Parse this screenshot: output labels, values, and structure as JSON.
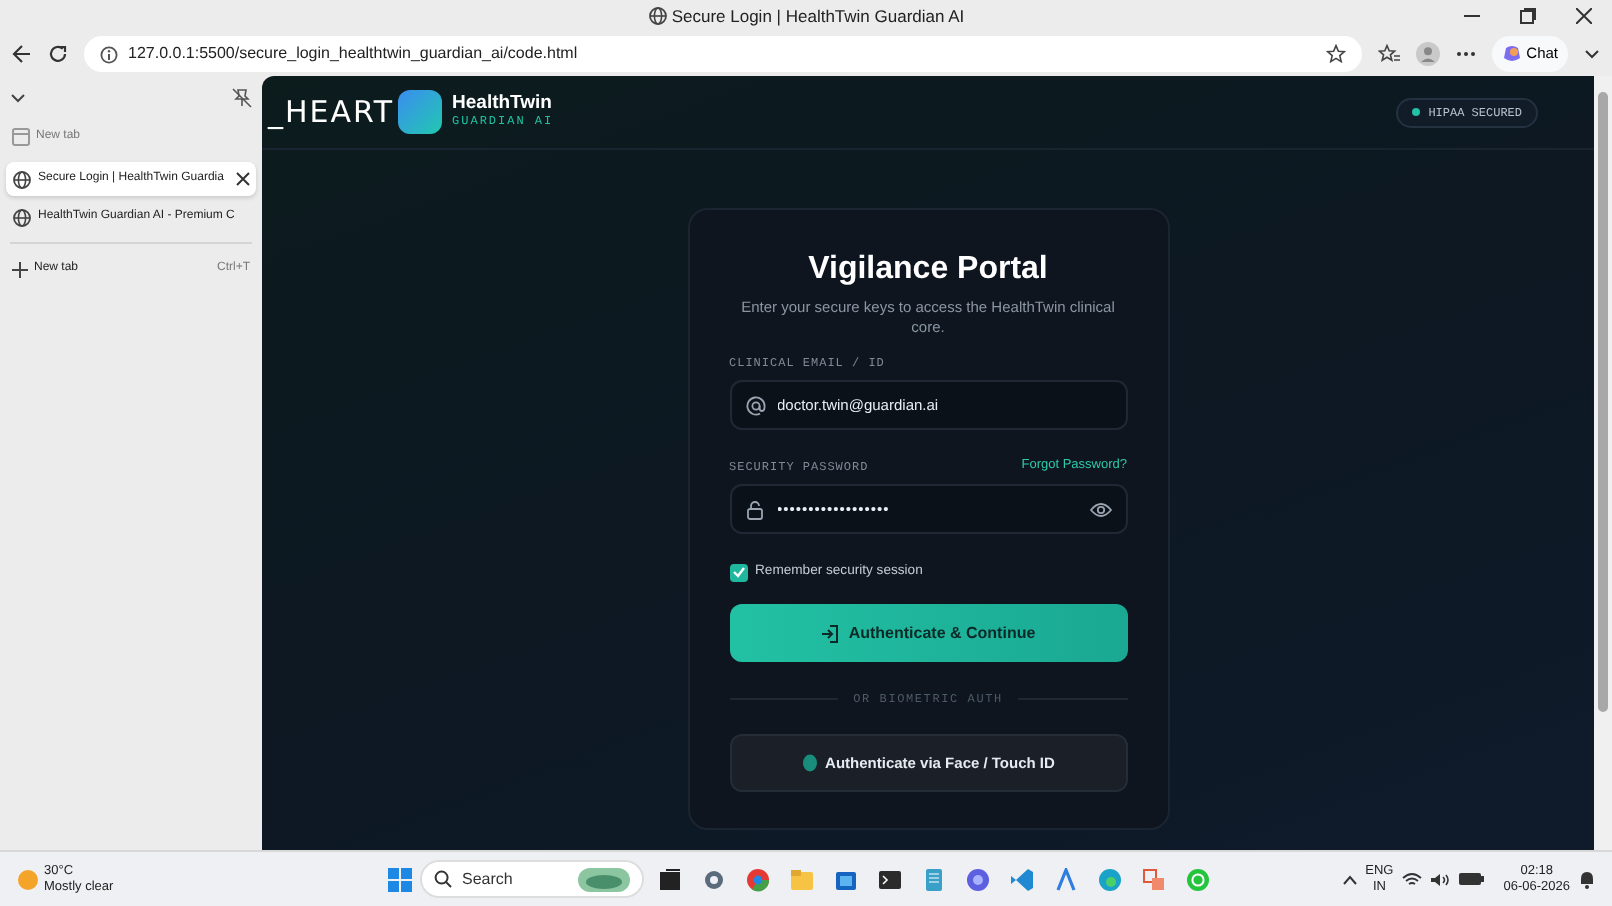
{
  "window": {
    "title": "Secure Login | HealthTwin Guardian AI"
  },
  "address_bar": {
    "url": "127.0.0.1:5500/secure_login_healthtwin_guardian_ai/code.html",
    "chat_label": "Chat"
  },
  "tab_sidebar": {
    "tabs": [
      {
        "kind": "blank",
        "label": "New tab",
        "selected": false
      },
      {
        "kind": "page",
        "label": "Secure Login | HealthTwin Guardia",
        "selected": true
      },
      {
        "kind": "page",
        "label": "HealthTwin Guardian AI - Premium C",
        "selected": false
      }
    ],
    "new_tab": {
      "label": "New tab",
      "shortcut": "Ctrl+T"
    }
  },
  "page": {
    "header": {
      "brand_prefix": "_HEART",
      "brand_name": "HealthTwin",
      "brand_sub": "GUARDIAN AI",
      "badge": "HIPAA SECURED"
    },
    "card": {
      "title": "Vigilance Portal",
      "subtitle": "Enter your secure keys to access the HealthTwin clinical core.",
      "email_label": "CLINICAL EMAIL / ID",
      "email_value": "doctor.twin@guardian.ai",
      "password_label": "SECURITY PASSWORD",
      "forgot_link": "Forgot Password?",
      "password_value": "••••••••••••••••••",
      "remember": {
        "label": "Remember security session",
        "checked": true
      },
      "primary_button": "Authenticate & Continue",
      "divider": "OR BIOMETRIC AUTH",
      "biometric_button": "Authenticate via Face / Touch ID"
    }
  },
  "taskbar": {
    "weather": {
      "temp": "30°C",
      "condition": "Mostly clear"
    },
    "search_placeholder": "Search",
    "language": "ENG",
    "region": "IN",
    "time": "02:18",
    "date": "06-06-2026"
  }
}
